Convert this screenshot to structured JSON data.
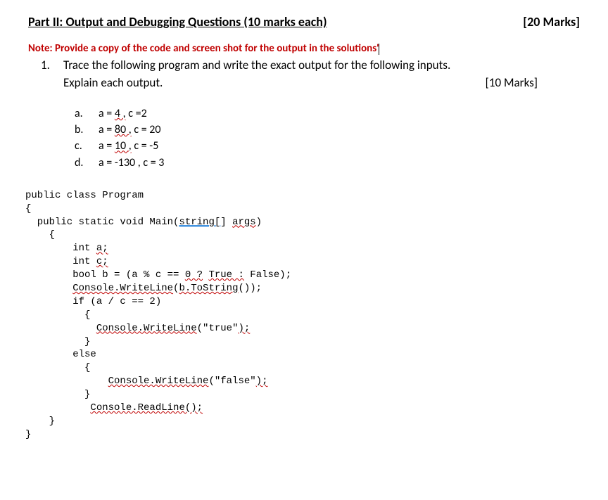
{
  "header": {
    "title": "Part II: Output and Debugging Questions (10 marks each)",
    "total_marks": "[20 Marks]"
  },
  "note": "Note: Provide a copy of the code and screen shot for the output in the solutions'",
  "question": {
    "number": "1.",
    "text": "Trace the following program and write the exact output for the following inputs.",
    "explain": "Explain each output.",
    "marks": "[10 Marks]"
  },
  "options": {
    "a": {
      "label": "a.",
      "pre": "a = ",
      "err": "4 ,",
      "post": " c =2"
    },
    "b": {
      "label": "b.",
      "pre": "a = ",
      "err": "80 ,",
      "post": " c = 20"
    },
    "c": {
      "label": "c.",
      "pre": "a = ",
      "err": "10 ,",
      "post": " c = -5"
    },
    "d": {
      "label": "d.",
      "text": "a = -130 , c = 3"
    }
  },
  "code": {
    "l1": "public class Program",
    "l2": "{",
    "l3a": "  public static void Main(",
    "l3b": "string[",
    "l3c": "] ",
    "l3d": "args",
    "l3e": ")",
    "l4": "    {",
    "l5a": "        int ",
    "l5b": "a;",
    "l6a": "        int ",
    "l6b": "c;",
    "l7a": "        bool b = (a % c == ",
    "l7b": "0 ?",
    "l7c": " ",
    "l7d": "True :",
    "l7e": " False);",
    "l8a": "        ",
    "l8b": "Console.WriteLine",
    "l8c": "(",
    "l8d": "b.ToString",
    "l8e": "());",
    "l9": "        if (a / c == 2)",
    "l10": "          {",
    "l11a": "            ",
    "l11b": "Console.WriteLine",
    "l11c": "(\"true\"",
    "l11d": ");",
    "l12": "          }",
    "l13": "        else",
    "l14": "          {",
    "l15a": "              ",
    "l15b": "Console.WriteLine",
    "l15c": "(\"false\"",
    "l15d": ");",
    "l16": "          }",
    "l17a": "           ",
    "l17b": "Console.ReadLine(",
    "l17c": ");",
    "l18": "    }",
    "l19": "}"
  }
}
